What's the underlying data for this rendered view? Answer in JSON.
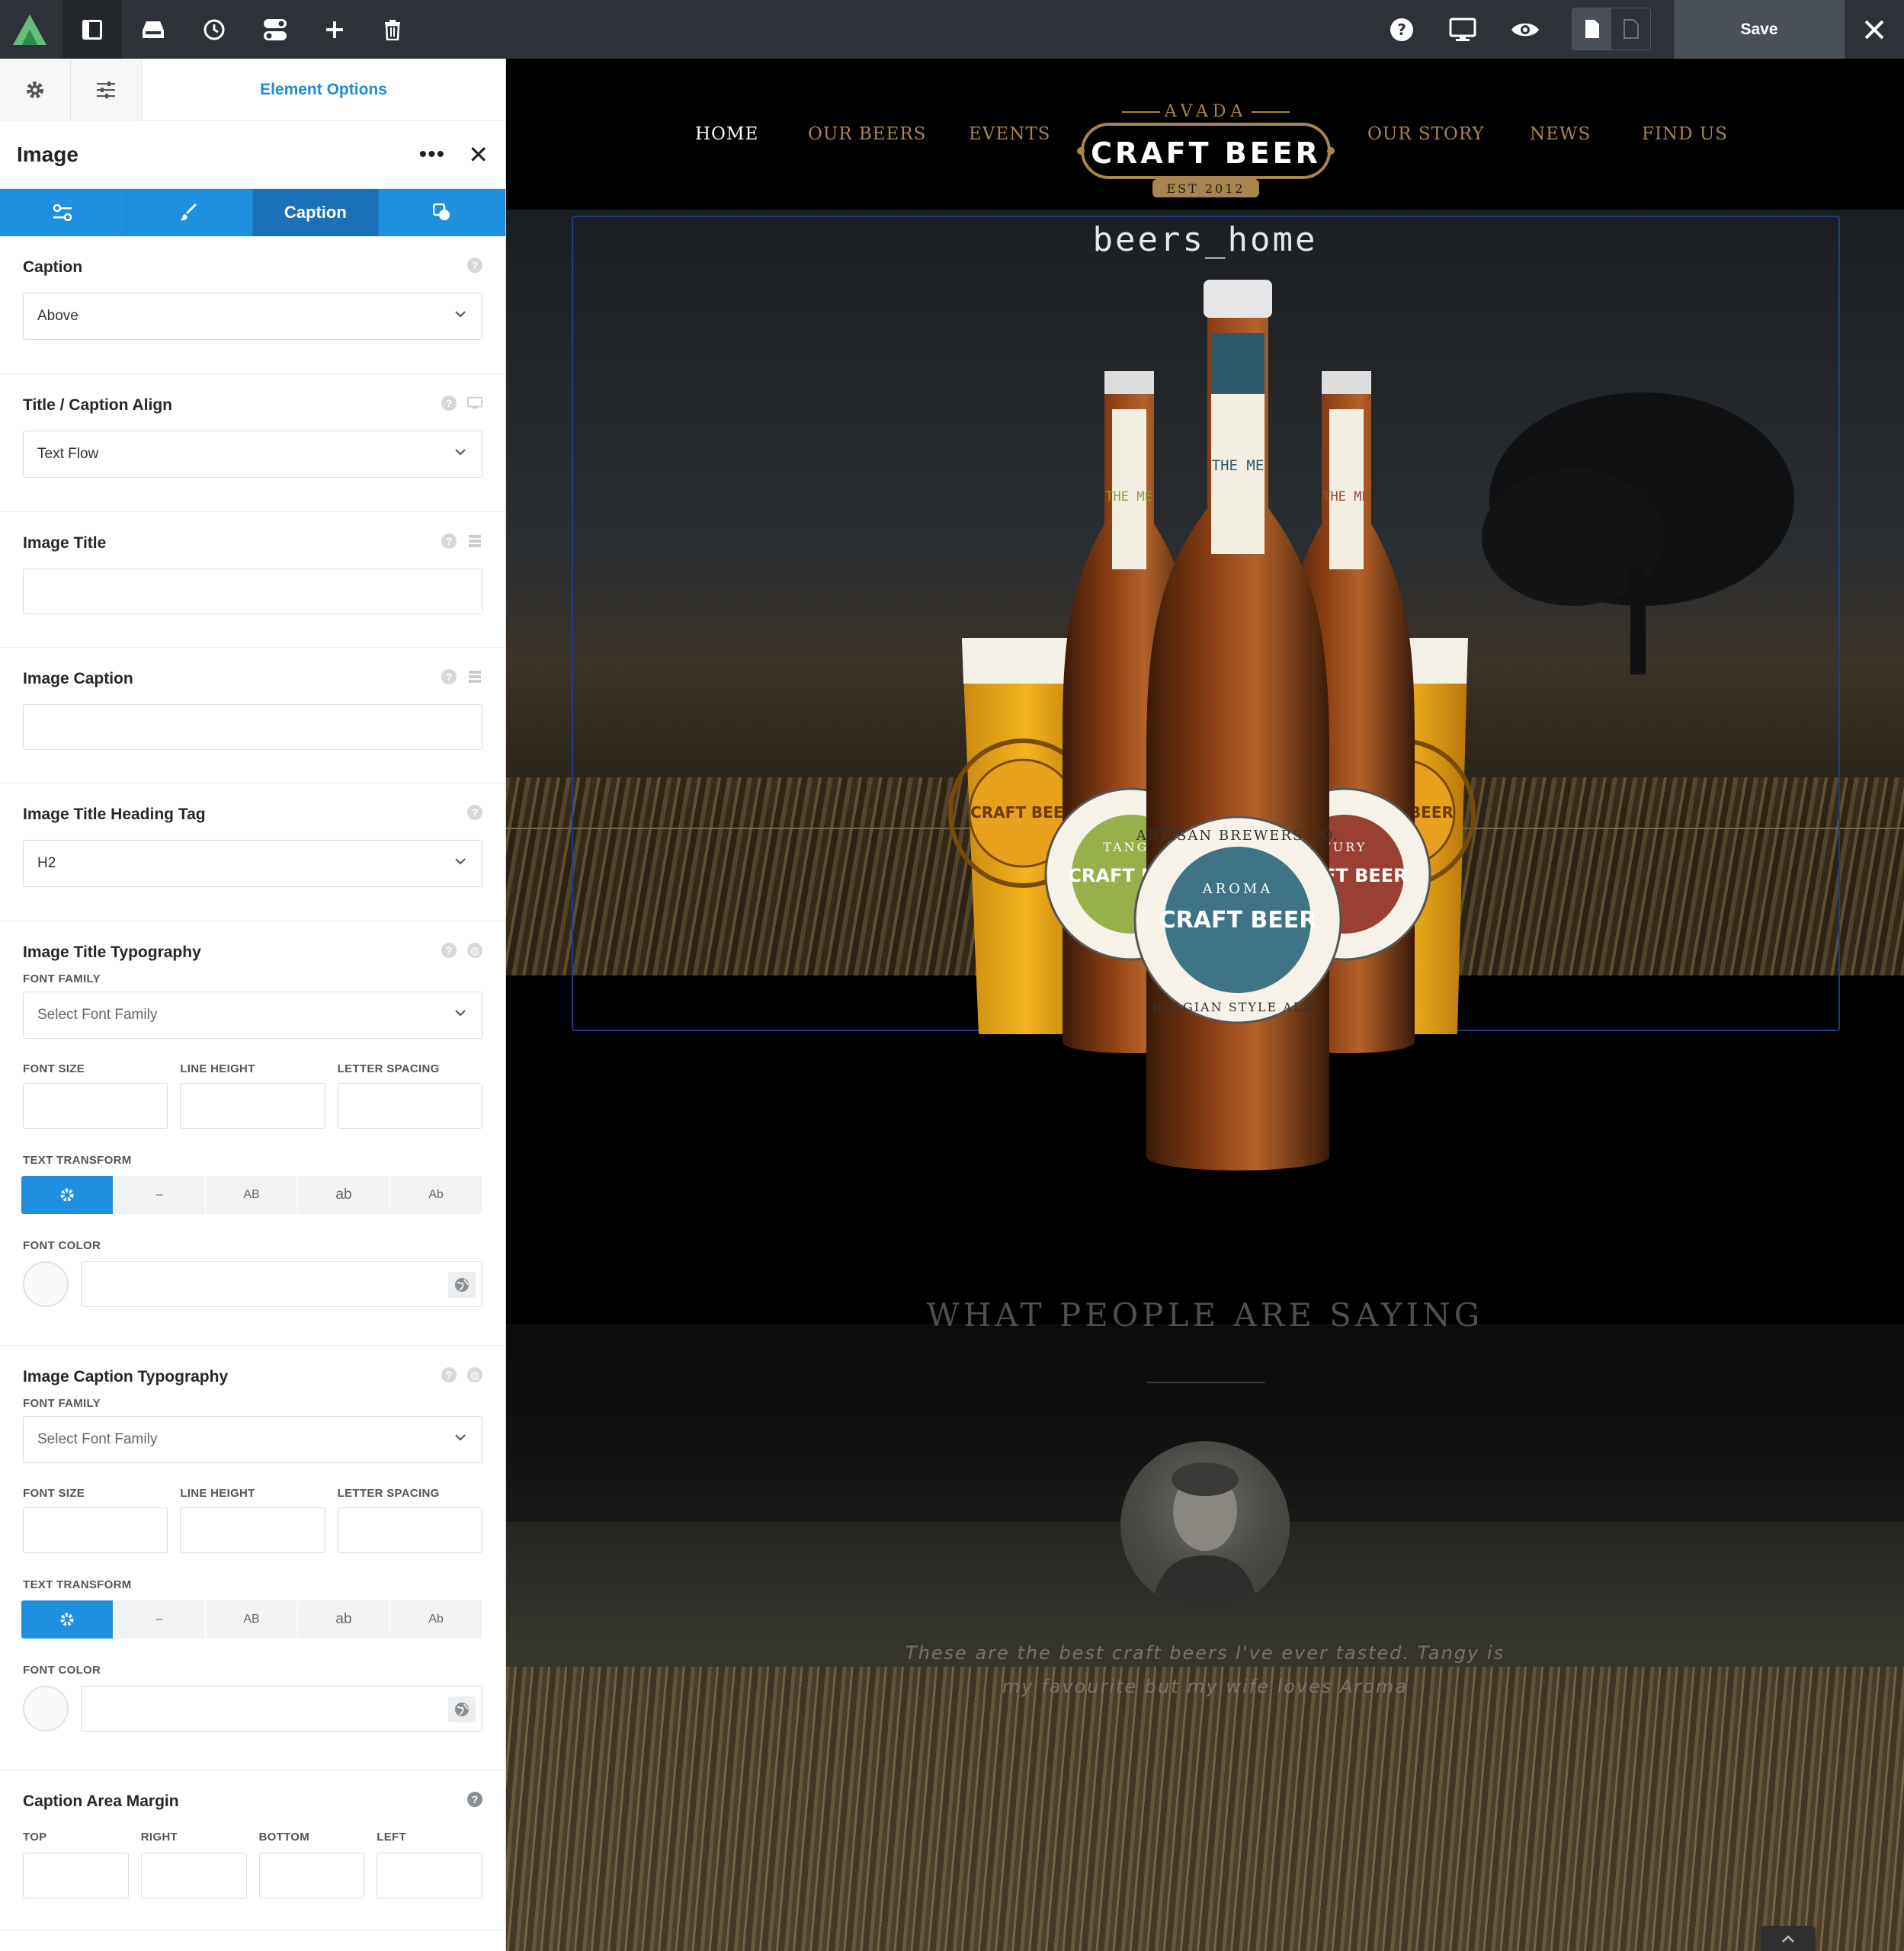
{
  "toolbar": {
    "save_label": "Save",
    "icons": [
      "avada-logo-icon",
      "sidebar-toggle-icon",
      "library-icon",
      "history-icon",
      "toggle-icon",
      "add-icon",
      "trash-icon",
      "help-icon",
      "desktop-preview-icon",
      "eye-icon",
      "page-icon",
      "page-outline-icon",
      "close-icon"
    ]
  },
  "panel": {
    "tab_label": "Element Options",
    "element_title": "Image",
    "sub_tabs": [
      "general",
      "design",
      "Caption",
      "extras"
    ],
    "active_sub_tab": "Caption",
    "caption": {
      "label": "Caption",
      "value": "Above"
    },
    "title_caption_align": {
      "label": "Title / Caption Align",
      "value": "Text Flow"
    },
    "image_title": {
      "label": "Image Title",
      "value": ""
    },
    "image_caption": {
      "label": "Image Caption",
      "value": ""
    },
    "heading_tag": {
      "label": "Image Title Heading Tag",
      "value": "H2"
    },
    "title_typography": {
      "label": "Image Title Typography",
      "font_family_label": "FONT FAMILY",
      "font_family_placeholder": "Select Font Family",
      "font_size_label": "FONT SIZE",
      "line_height_label": "LINE HEIGHT",
      "letter_spacing_label": "LETTER SPACING",
      "text_transform_label": "TEXT TRANSFORM",
      "transform_options": [
        "–",
        "AB",
        "ab",
        "Ab"
      ],
      "font_color_label": "FONT COLOR"
    },
    "caption_typography": {
      "label": "Image Caption Typography",
      "font_family_label": "FONT FAMILY",
      "font_family_placeholder": "Select Font Family",
      "font_size_label": "FONT SIZE",
      "line_height_label": "LINE HEIGHT",
      "letter_spacing_label": "LETTER SPACING",
      "text_transform_label": "TEXT TRANSFORM",
      "transform_options": [
        "–",
        "AB",
        "ab",
        "Ab"
      ],
      "font_color_label": "FONT COLOR"
    },
    "caption_margin": {
      "label": "Caption Area Margin",
      "top": "TOP",
      "right": "RIGHT",
      "bottom": "BOTTOM",
      "left": "LEFT"
    }
  },
  "site": {
    "nav": [
      "HOME",
      "OUR BEERS",
      "EVENTS",
      "OUR STORY",
      "NEWS",
      "FIND US"
    ],
    "logo": {
      "top": "AVADA",
      "main": "CRAFT BEER",
      "est": "EST 2012"
    },
    "image_caption": "beers_home",
    "section_title": "WHAT PEOPLE ARE SAYING",
    "quote": "These are the best craft beers I've ever tasted. Tangy is my favourite but my wife loves Aroma",
    "bottle_labels": {
      "neck": "THE ME FUS ION",
      "left_flavor": "TANGY",
      "center_flavor": "AROMA",
      "right_flavor": "FURY",
      "craft": "CRAFT BEER",
      "ring": "ARTISAN BREWERS CO.",
      "ring_bottom": "BELGIAN STYLE ALES"
    }
  },
  "colors": {
    "accent": "#1f8fe0",
    "toolbar_bg": "#2d3238",
    "nav_gold": "#a8844f",
    "selection": "#1d3c8a"
  }
}
